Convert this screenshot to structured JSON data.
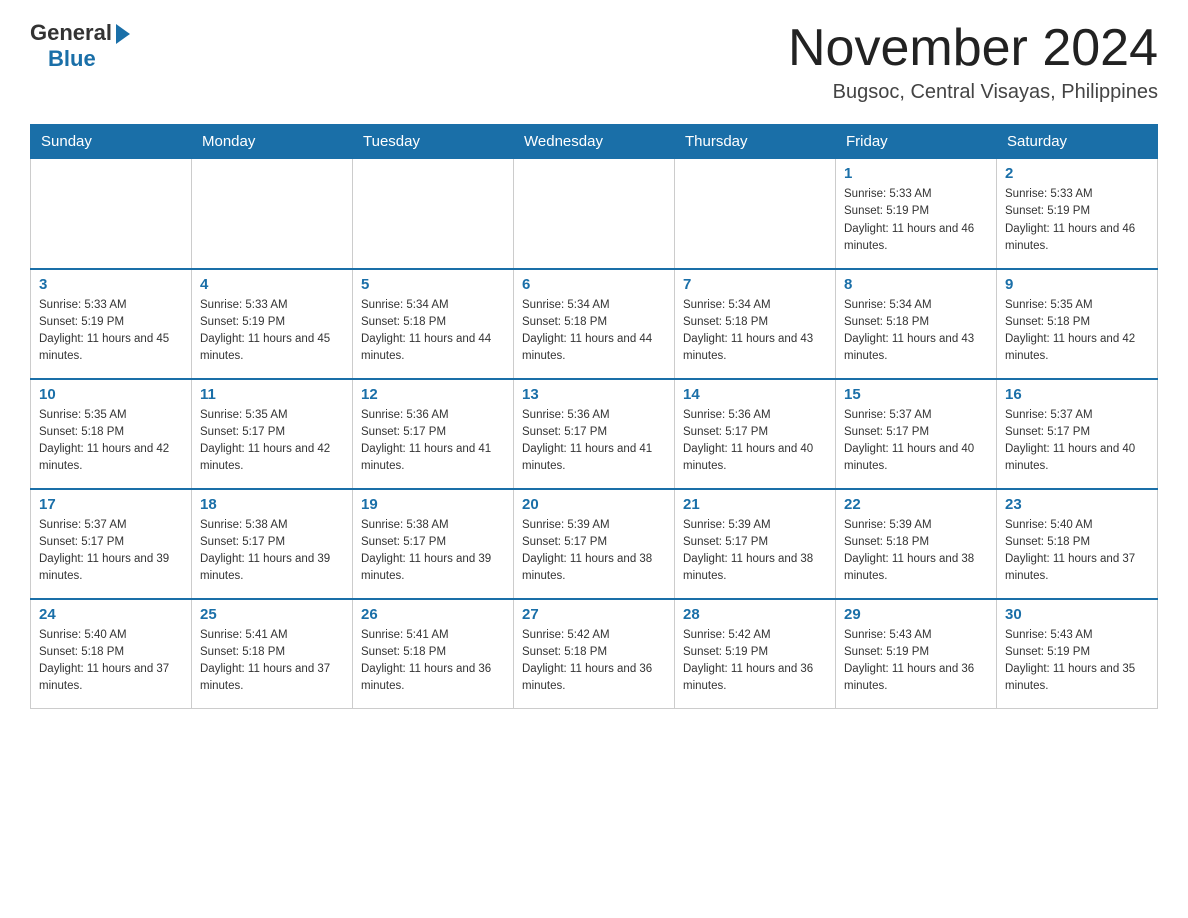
{
  "header": {
    "logo_general": "General",
    "logo_blue": "Blue",
    "month_title": "November 2024",
    "subtitle": "Bugsoc, Central Visayas, Philippines"
  },
  "days_of_week": [
    "Sunday",
    "Monday",
    "Tuesday",
    "Wednesday",
    "Thursday",
    "Friday",
    "Saturday"
  ],
  "weeks": [
    [
      {
        "day": "",
        "info": ""
      },
      {
        "day": "",
        "info": ""
      },
      {
        "day": "",
        "info": ""
      },
      {
        "day": "",
        "info": ""
      },
      {
        "day": "",
        "info": ""
      },
      {
        "day": "1",
        "info": "Sunrise: 5:33 AM\nSunset: 5:19 PM\nDaylight: 11 hours and 46 minutes."
      },
      {
        "day": "2",
        "info": "Sunrise: 5:33 AM\nSunset: 5:19 PM\nDaylight: 11 hours and 46 minutes."
      }
    ],
    [
      {
        "day": "3",
        "info": "Sunrise: 5:33 AM\nSunset: 5:19 PM\nDaylight: 11 hours and 45 minutes."
      },
      {
        "day": "4",
        "info": "Sunrise: 5:33 AM\nSunset: 5:19 PM\nDaylight: 11 hours and 45 minutes."
      },
      {
        "day": "5",
        "info": "Sunrise: 5:34 AM\nSunset: 5:18 PM\nDaylight: 11 hours and 44 minutes."
      },
      {
        "day": "6",
        "info": "Sunrise: 5:34 AM\nSunset: 5:18 PM\nDaylight: 11 hours and 44 minutes."
      },
      {
        "day": "7",
        "info": "Sunrise: 5:34 AM\nSunset: 5:18 PM\nDaylight: 11 hours and 43 minutes."
      },
      {
        "day": "8",
        "info": "Sunrise: 5:34 AM\nSunset: 5:18 PM\nDaylight: 11 hours and 43 minutes."
      },
      {
        "day": "9",
        "info": "Sunrise: 5:35 AM\nSunset: 5:18 PM\nDaylight: 11 hours and 42 minutes."
      }
    ],
    [
      {
        "day": "10",
        "info": "Sunrise: 5:35 AM\nSunset: 5:18 PM\nDaylight: 11 hours and 42 minutes."
      },
      {
        "day": "11",
        "info": "Sunrise: 5:35 AM\nSunset: 5:17 PM\nDaylight: 11 hours and 42 minutes."
      },
      {
        "day": "12",
        "info": "Sunrise: 5:36 AM\nSunset: 5:17 PM\nDaylight: 11 hours and 41 minutes."
      },
      {
        "day": "13",
        "info": "Sunrise: 5:36 AM\nSunset: 5:17 PM\nDaylight: 11 hours and 41 minutes."
      },
      {
        "day": "14",
        "info": "Sunrise: 5:36 AM\nSunset: 5:17 PM\nDaylight: 11 hours and 40 minutes."
      },
      {
        "day": "15",
        "info": "Sunrise: 5:37 AM\nSunset: 5:17 PM\nDaylight: 11 hours and 40 minutes."
      },
      {
        "day": "16",
        "info": "Sunrise: 5:37 AM\nSunset: 5:17 PM\nDaylight: 11 hours and 40 minutes."
      }
    ],
    [
      {
        "day": "17",
        "info": "Sunrise: 5:37 AM\nSunset: 5:17 PM\nDaylight: 11 hours and 39 minutes."
      },
      {
        "day": "18",
        "info": "Sunrise: 5:38 AM\nSunset: 5:17 PM\nDaylight: 11 hours and 39 minutes."
      },
      {
        "day": "19",
        "info": "Sunrise: 5:38 AM\nSunset: 5:17 PM\nDaylight: 11 hours and 39 minutes."
      },
      {
        "day": "20",
        "info": "Sunrise: 5:39 AM\nSunset: 5:17 PM\nDaylight: 11 hours and 38 minutes."
      },
      {
        "day": "21",
        "info": "Sunrise: 5:39 AM\nSunset: 5:17 PM\nDaylight: 11 hours and 38 minutes."
      },
      {
        "day": "22",
        "info": "Sunrise: 5:39 AM\nSunset: 5:18 PM\nDaylight: 11 hours and 38 minutes."
      },
      {
        "day": "23",
        "info": "Sunrise: 5:40 AM\nSunset: 5:18 PM\nDaylight: 11 hours and 37 minutes."
      }
    ],
    [
      {
        "day": "24",
        "info": "Sunrise: 5:40 AM\nSunset: 5:18 PM\nDaylight: 11 hours and 37 minutes."
      },
      {
        "day": "25",
        "info": "Sunrise: 5:41 AM\nSunset: 5:18 PM\nDaylight: 11 hours and 37 minutes."
      },
      {
        "day": "26",
        "info": "Sunrise: 5:41 AM\nSunset: 5:18 PM\nDaylight: 11 hours and 36 minutes."
      },
      {
        "day": "27",
        "info": "Sunrise: 5:42 AM\nSunset: 5:18 PM\nDaylight: 11 hours and 36 minutes."
      },
      {
        "day": "28",
        "info": "Sunrise: 5:42 AM\nSunset: 5:19 PM\nDaylight: 11 hours and 36 minutes."
      },
      {
        "day": "29",
        "info": "Sunrise: 5:43 AM\nSunset: 5:19 PM\nDaylight: 11 hours and 36 minutes."
      },
      {
        "day": "30",
        "info": "Sunrise: 5:43 AM\nSunset: 5:19 PM\nDaylight: 11 hours and 35 minutes."
      }
    ]
  ]
}
